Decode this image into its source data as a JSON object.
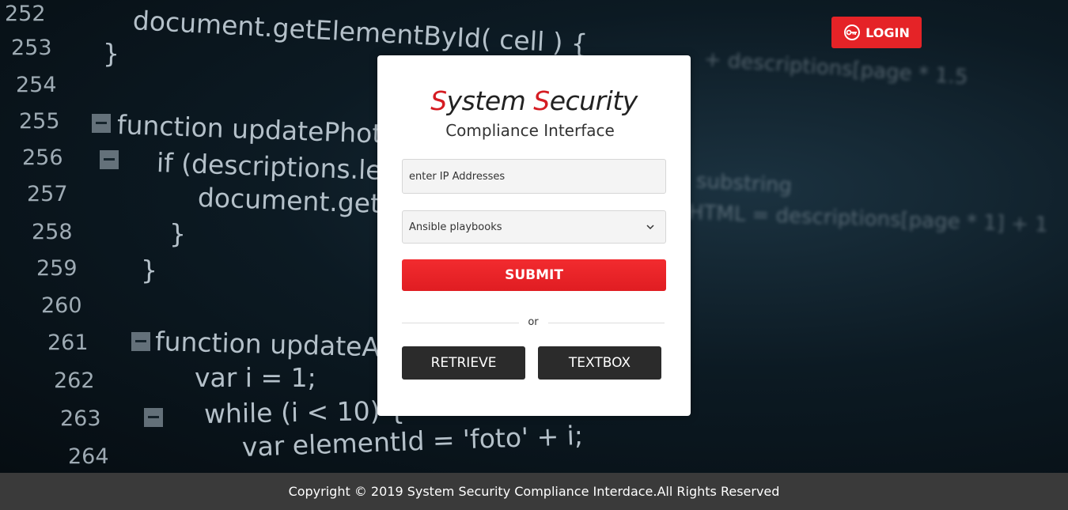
{
  "header": {
    "login_label": "LOGIN"
  },
  "card": {
    "title_parts": [
      "S",
      "ystem ",
      "S",
      "ecurity"
    ],
    "subtitle": "Compliance Interface",
    "ip_placeholder": "enter IP Addresses",
    "select_value": "Ansible playbooks",
    "submit_label": "SUBMIT",
    "or_label": "or",
    "retrieve_label": "RETRIEVE",
    "textbox_label": "TEXTBOX"
  },
  "footer": {
    "copyright": "Copyright © 2019 System Security Compliance Interdace.All Rights Reserved"
  },
  "background": {
    "line_numbers": [
      "252",
      "253",
      "254",
      "255",
      "256",
      "257",
      "258",
      "259",
      "260",
      "261",
      "262",
      "263",
      "264"
    ],
    "code_lines": [
      "document.getElementById( cell ) {",
      "}",
      "function updatePhotoD",
      "if (descriptions.leng",
      "document.getEl",
      "}",
      "}",
      "function updateAllI",
      "var i = 1;",
      "while (i < 10) {",
      "var elementId = 'foto' + i;"
    ],
    "blurred_code": [
      "+ descriptions[page * 1.5",
      "substring",
      "HTML = descriptions[page * 1] + 1"
    ]
  },
  "colors": {
    "accent_red": "#e52327",
    "title_red": "#d51c22",
    "dark_button": "#2b2b2b",
    "footer_bg": "#3a3a3a"
  },
  "icons": {
    "login": "key-login-icon",
    "select": "chevron-down-icon"
  }
}
